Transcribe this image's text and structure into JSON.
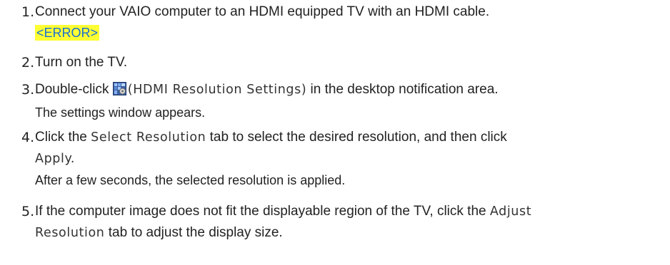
{
  "steps": [
    {
      "number": "1.",
      "text": "Connect your VAIO computer to an HDMI equipped TV with an HDMI cable.",
      "error_tag": "<ERROR>"
    },
    {
      "number": "2.",
      "text": "Turn on the TV."
    },
    {
      "number": "3.",
      "pre": "Double-click",
      "ui_name": "(HDMI Resolution Settings)",
      "post": "in the desktop notification area.",
      "result": "The settings window appears.",
      "icon": "hdmi-settings-icon"
    },
    {
      "number": "4.",
      "pre": "Click the",
      "ui_name": "Select Resolution",
      "post": "tab to select the desired resolution, and then click",
      "ui_name_2": "Apply.",
      "result": "After a few seconds, the selected resolution is applied."
    },
    {
      "number": "5.",
      "pre": "If the computer image does not fit the displayable region of the TV, click the",
      "ui_name": "Adjust",
      "ui_name_cont": "Resolution",
      "post": "tab to adjust the display size."
    }
  ],
  "colors": {
    "error_highlight": "#ffff33",
    "error_text": "#1a6fd1",
    "body_text": "#222222"
  }
}
